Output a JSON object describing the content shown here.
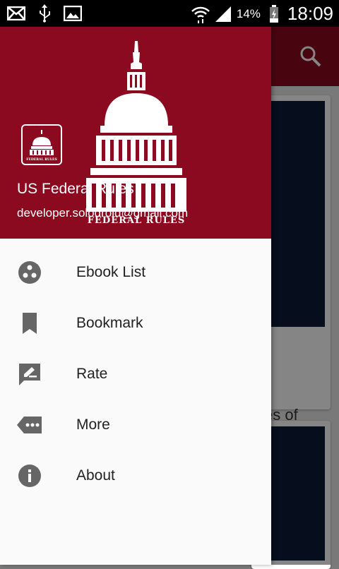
{
  "status_bar": {
    "battery_percent": "14%",
    "time": "18:09"
  },
  "app": {
    "card_title_fragment": "es of",
    "search_icon": "search-icon"
  },
  "drawer": {
    "header": {
      "logo_text": "FEDERAL RULES",
      "app_name": "US Federal Rules",
      "email": "developer.solodroid@gmail.com",
      "brand_color": "#8b0a1f"
    },
    "items": [
      {
        "label": "Ebook List",
        "icon": "ebook-list-icon"
      },
      {
        "label": "Bookmark",
        "icon": "bookmark-icon"
      },
      {
        "label": "Rate",
        "icon": "rate-icon"
      },
      {
        "label": "More",
        "icon": "more-icon"
      },
      {
        "label": "About",
        "icon": "info-icon"
      }
    ]
  }
}
